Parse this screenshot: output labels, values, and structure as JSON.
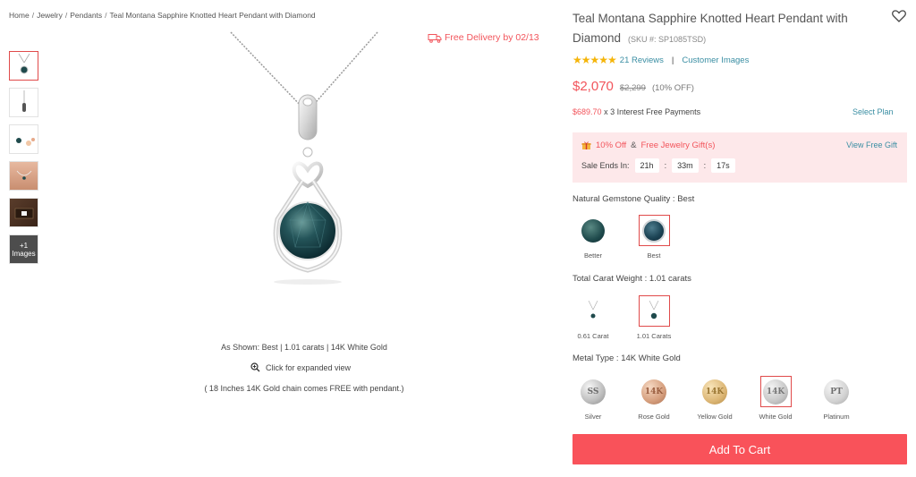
{
  "breadcrumb": [
    "Home",
    "Jewelry",
    "Pendants",
    "Teal Montana Sapphire Knotted Heart Pendant with Diamond"
  ],
  "gallery": {
    "thumbs": [
      "pendant-front",
      "pendant-side",
      "pendant-scale",
      "pendant-on-neck",
      "gift-box",
      "more-images"
    ],
    "more_count": "+1",
    "more_label": "Images"
  },
  "delivery": "Free Delivery by 02/13",
  "image_caption": {
    "as_shown": "As Shown: Best | 1.01 carats | 14K White Gold",
    "expand": "Click for expanded view",
    "chain_note": "( 18 Inches 14K Gold chain comes FREE with pendant.)"
  },
  "product": {
    "title": "Teal Montana Sapphire Knotted Heart Pendant with Diamond",
    "sku": "(SKU #: SP1085TSD)",
    "rating_stars": 5,
    "reviews": "21 Reviews",
    "divider": "|",
    "customer_images": "Customer Images",
    "price": "$2,070",
    "old_price": "$2,299",
    "discount": "(10% OFF)",
    "installment_amount": "$689.70",
    "installment_text": "x 3 Interest Free Payments",
    "select_plan": "Select Plan"
  },
  "promo": {
    "offer": "10% Off",
    "amp": "&",
    "gift": "Free Jewelry Gift(s)",
    "view_gift": "View Free Gift",
    "sale_label": "Sale Ends In:",
    "hours": "21h",
    "minutes": "33m",
    "seconds": "17s",
    "sep": ":"
  },
  "quality": {
    "label": "Natural Gemstone Quality : Best",
    "options": [
      {
        "name": "Better"
      },
      {
        "name": "Best"
      }
    ],
    "selected": "Best"
  },
  "carat": {
    "label": "Total Carat Weight : 1.01 carats",
    "options": [
      {
        "name": "0.61 Carat"
      },
      {
        "name": "1.01 Carats"
      }
    ],
    "selected": "1.01 Carats"
  },
  "metal": {
    "label": "Metal Type : 14K White Gold",
    "options": [
      {
        "name": "Silver",
        "mark": "SS"
      },
      {
        "name": "Rose Gold",
        "mark": "14K"
      },
      {
        "name": "Yellow Gold",
        "mark": "14K"
      },
      {
        "name": "White Gold",
        "mark": "14K"
      },
      {
        "name": "Platinum",
        "mark": "PT"
      }
    ],
    "selected": "White Gold"
  },
  "cart_label": "Add To Cart",
  "colors": {
    "accent": "#f9525a",
    "link": "#3a8ea3",
    "promo_bg": "#fde8ea",
    "star": "#f5b50a"
  }
}
